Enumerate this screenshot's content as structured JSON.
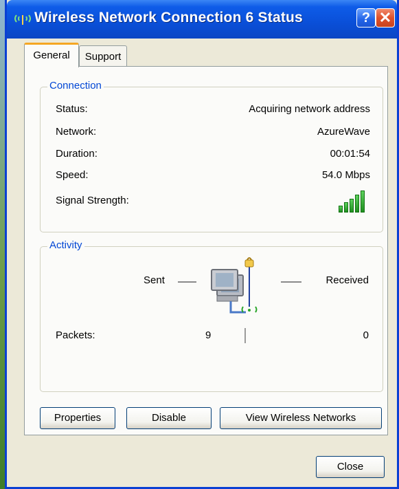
{
  "window": {
    "title": "Wireless Network Connection 6 Status",
    "help_label": "?",
    "close_label": "✕"
  },
  "tabs": [
    {
      "label": "General",
      "selected": true
    },
    {
      "label": "Support",
      "selected": false
    }
  ],
  "connection": {
    "legend": "Connection",
    "rows": [
      {
        "label": "Status:",
        "value": "Acquiring network address"
      },
      {
        "label": "Network:",
        "value": "AzureWave"
      },
      {
        "label": "Duration:",
        "value": "00:01:54"
      },
      {
        "label": "Speed:",
        "value": "54.0 Mbps"
      }
    ],
    "signal_label": "Signal Strength:",
    "signal_bars": 5,
    "signal_color": "#2aa52a"
  },
  "activity": {
    "legend": "Activity",
    "sent_label": "Sent",
    "received_label": "Received",
    "packets_label": "Packets:",
    "packets_sent": "9",
    "packets_received": "0"
  },
  "buttons": {
    "properties": "Properties",
    "disable": "Disable",
    "view_wireless": "View Wireless Networks",
    "close": "Close"
  },
  "colors": {
    "titlebar": "#0a4fd8",
    "legend_text": "#0046d5",
    "tab_highlight": "#f5a623"
  }
}
